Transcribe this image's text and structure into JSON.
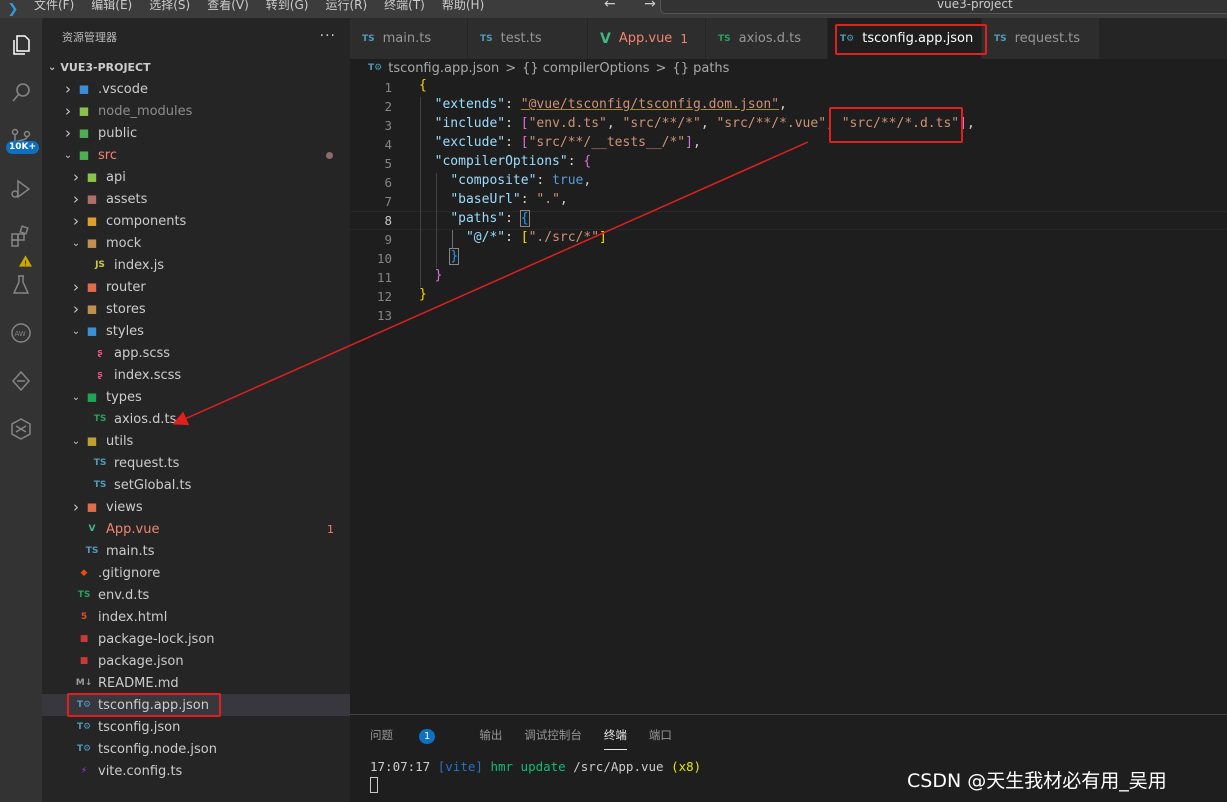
{
  "menu": [
    "文件(F)",
    "编辑(E)",
    "选择(S)",
    "查看(V)",
    "转到(G)",
    "运行(R)",
    "终端(T)",
    "帮助(H)"
  ],
  "window_title": "vue3-project",
  "nav_arrows": "←  →",
  "activity": {
    "badge": "10K+"
  },
  "explorer": {
    "header": "资源管理器",
    "more": "···",
    "project": "VUE3-PROJECT",
    "tree": [
      {
        "label": ".vscode",
        "depth": 0,
        "chev": "right",
        "icon": "vscode-folder",
        "color": "#cccccc"
      },
      {
        "label": "node_modules",
        "depth": 0,
        "chev": "right",
        "icon": "node-folder",
        "color": "#8c8c8c"
      },
      {
        "label": "public",
        "depth": 0,
        "chev": "right",
        "icon": "public-folder",
        "color": "#cccccc"
      },
      {
        "label": "src",
        "depth": 0,
        "chev": "down",
        "icon": "src-folder",
        "color": "#f0846f"
      },
      {
        "label": "api",
        "depth": 1,
        "chev": "right",
        "icon": "api-folder",
        "color": "#cccccc"
      },
      {
        "label": "assets",
        "depth": 1,
        "chev": "right",
        "icon": "assets-folder",
        "color": "#cccccc"
      },
      {
        "label": "components",
        "depth": 1,
        "chev": "right",
        "icon": "components-folder",
        "color": "#cccccc"
      },
      {
        "label": "mock",
        "depth": 1,
        "chev": "down",
        "icon": "mock-folder",
        "color": "#cccccc"
      },
      {
        "label": "index.js",
        "depth": 2,
        "chev": "",
        "icon": "js",
        "color": "#cccccc"
      },
      {
        "label": "router",
        "depth": 1,
        "chev": "right",
        "icon": "router-folder",
        "color": "#cccccc"
      },
      {
        "label": "stores",
        "depth": 1,
        "chev": "right",
        "icon": "stores-folder",
        "color": "#cccccc"
      },
      {
        "label": "styles",
        "depth": 1,
        "chev": "down",
        "icon": "styles-folder",
        "color": "#cccccc"
      },
      {
        "label": "app.scss",
        "depth": 2,
        "chev": "",
        "icon": "scss",
        "color": "#cccccc"
      },
      {
        "label": "index.scss",
        "depth": 2,
        "chev": "",
        "icon": "scss",
        "color": "#cccccc"
      },
      {
        "label": "types",
        "depth": 1,
        "chev": "down",
        "icon": "types-folder",
        "color": "#cccccc"
      },
      {
        "label": "axios.d.ts",
        "depth": 2,
        "chev": "",
        "icon": "dts",
        "color": "#cccccc"
      },
      {
        "label": "utils",
        "depth": 1,
        "chev": "down",
        "icon": "utils-folder",
        "color": "#cccccc"
      },
      {
        "label": "request.ts",
        "depth": 2,
        "chev": "",
        "icon": "ts",
        "color": "#cccccc"
      },
      {
        "label": "setGlobal.ts",
        "depth": 2,
        "chev": "",
        "icon": "ts",
        "color": "#cccccc"
      },
      {
        "label": "views",
        "depth": 1,
        "chev": "right",
        "icon": "views-folder",
        "color": "#cccccc"
      },
      {
        "label": "App.vue",
        "depth": 1,
        "chev": "",
        "icon": "vue",
        "color": "#f0846f",
        "mod": "1"
      },
      {
        "label": "main.ts",
        "depth": 1,
        "chev": "",
        "icon": "ts",
        "color": "#cccccc"
      },
      {
        "label": ".gitignore",
        "depth": 0,
        "chev": "",
        "icon": "git",
        "color": "#cccccc"
      },
      {
        "label": "env.d.ts",
        "depth": 0,
        "chev": "",
        "icon": "dts",
        "color": "#cccccc"
      },
      {
        "label": "index.html",
        "depth": 0,
        "chev": "",
        "icon": "html",
        "color": "#cccccc"
      },
      {
        "label": "package-lock.json",
        "depth": 0,
        "chev": "",
        "icon": "npm",
        "color": "#cccccc"
      },
      {
        "label": "package.json",
        "depth": 0,
        "chev": "",
        "icon": "npm",
        "color": "#cccccc"
      },
      {
        "label": "README.md",
        "depth": 0,
        "chev": "",
        "icon": "md",
        "color": "#cccccc"
      },
      {
        "label": "tsconfig.app.json",
        "depth": 0,
        "chev": "",
        "icon": "tsconfig",
        "color": "#cccccc",
        "selected": true
      },
      {
        "label": "tsconfig.json",
        "depth": 0,
        "chev": "",
        "icon": "tsconfig",
        "color": "#cccccc"
      },
      {
        "label": "tsconfig.node.json",
        "depth": 0,
        "chev": "",
        "icon": "tsconfig",
        "color": "#cccccc"
      },
      {
        "label": "vite.config.ts",
        "depth": 0,
        "chev": "",
        "icon": "vite",
        "color": "#cccccc"
      }
    ]
  },
  "tabs": [
    {
      "label": "main.ts",
      "icon": "TS",
      "icon_color": "#519aba",
      "color": "#969696"
    },
    {
      "label": "test.ts",
      "icon": "TS",
      "icon_color": "#519aba",
      "color": "#969696"
    },
    {
      "label": "App.vue",
      "icon": "V",
      "icon_color": "#41b883",
      "color": "#f0846f",
      "mod": "1"
    },
    {
      "label": "axios.d.ts",
      "icon": "TS",
      "icon_color": "#23a355",
      "color": "#969696"
    },
    {
      "label": "tsconfig.app.json",
      "icon": "T⚙",
      "icon_color": "#519aba",
      "color": "#ffffff",
      "active": true,
      "close": "✕"
    },
    {
      "label": "request.ts",
      "icon": "TS",
      "icon_color": "#519aba",
      "color": "#969696"
    }
  ],
  "breadcrumb": {
    "file": "tsconfig.app.json",
    "sep": ">",
    "items": [
      "{} compilerOptions",
      "{} paths"
    ]
  },
  "code_lines": [
    "1",
    "2",
    "3",
    "4",
    "5",
    "6",
    "7",
    "8",
    "9",
    "10",
    "11",
    "12",
    "13"
  ],
  "code": {
    "l1": "{",
    "l2_key": "\"extends\"",
    "l2_val": "\"@vue/tsconfig/tsconfig.dom.json\"",
    "l3_key": "\"include\"",
    "l3_v1": "\"env.d.ts\"",
    "l3_v2": "\"src/**/*\"",
    "l3_v3": "\"src/**/*.vue\"",
    "l3_v4": "\"src/**/*.d.ts\"",
    "l4_key": "\"exclude\"",
    "l4_v1": "\"src/**/__tests__/*\"",
    "l5_key": "\"compilerOptions\"",
    "l6_key": "\"composite\"",
    "l6_val": "true",
    "l7_key": "\"baseUrl\"",
    "l7_val": "\".\"",
    "l8_key": "\"paths\"",
    "l9_key": "\"@/*\"",
    "l9_val": "\"./src/*\""
  },
  "panel": {
    "tabs": [
      "问题",
      "输出",
      "调试控制台",
      "终端",
      "端口"
    ],
    "problems_badge": "1",
    "term_time": "17:07:17",
    "term_vite": "[vite]",
    "term_hmr": "hmr update",
    "term_path": "/src/App.vue",
    "term_count": "(x8)"
  },
  "watermark": "CSDN @天生我材必有用_吴用",
  "colors": {
    "highlight": "#e0201e",
    "accent": "#0e70c0"
  }
}
